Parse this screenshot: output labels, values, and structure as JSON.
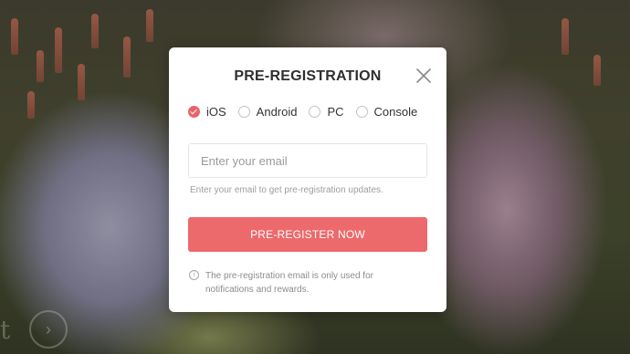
{
  "modal": {
    "title": "PRE-REGISTRATION",
    "close_icon": "close-icon"
  },
  "platforms": [
    {
      "label": "iOS",
      "checked": true
    },
    {
      "label": "Android",
      "checked": false
    },
    {
      "label": "PC",
      "checked": false
    },
    {
      "label": "Console",
      "checked": false
    }
  ],
  "email": {
    "value": "",
    "placeholder": "Enter your email",
    "hint": "Enter your email to get pre-registration updates."
  },
  "submit": {
    "label": "PRE-REGISTER NOW"
  },
  "notice": {
    "icon": "info-icon",
    "text": "The pre-registration email is only used for notifications and rewards."
  },
  "colors": {
    "accent": "#ec6a6c",
    "radio_checked": "#e8646a",
    "title": "#2f2f2f",
    "hint": "#9d9d9d"
  }
}
